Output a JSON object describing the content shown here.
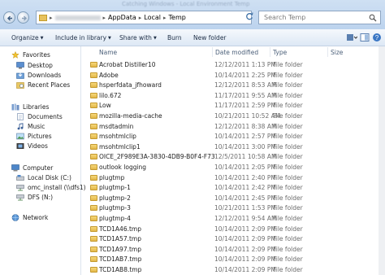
{
  "window": {
    "title": "Catching Windows - Local Environment Temp"
  },
  "address": {
    "segments": [
      "AppData",
      "Local",
      "Temp"
    ]
  },
  "search": {
    "placeholder": "Search Temp"
  },
  "toolbar": {
    "organize": "Organize",
    "include": "Include in library",
    "share": "Share with",
    "burn": "Burn",
    "new_folder": "New folder"
  },
  "nav": {
    "favorites": "Favorites",
    "desktop": "Desktop",
    "downloads": "Downloads",
    "recent": "Recent Places",
    "libraries": "Libraries",
    "documents": "Documents",
    "music": "Music",
    "pictures": "Pictures",
    "videos": "Videos",
    "computer": "Computer",
    "local_disk": "Local Disk (C:)",
    "omc": "omc_install (\\\\dfs1)",
    "dfs": "DFS (N:)",
    "network": "Network"
  },
  "columns": {
    "name": "Name",
    "date": "Date modified",
    "type": "Type",
    "size": "Size"
  },
  "files": [
    {
      "name": "Acrobat Distiller10",
      "date": "12/12/2011 1:13 PM",
      "type": "File folder"
    },
    {
      "name": "Adobe",
      "date": "10/14/2011 2:25 PM",
      "type": "File folder"
    },
    {
      "name": "hsperfdata_jfhoward",
      "date": "12/12/2011 8:53 AM",
      "type": "File folder"
    },
    {
      "name": "lilo.672",
      "date": "11/17/2011 9:55 AM",
      "type": "File folder"
    },
    {
      "name": "Low",
      "date": "11/17/2011 2:59 PM",
      "type": "File folder"
    },
    {
      "name": "mozilla-media-cache",
      "date": "10/21/2011 10:52 AM",
      "type": "File folder"
    },
    {
      "name": "msdtadmin",
      "date": "12/12/2011 8:38 AM",
      "type": "File folder"
    },
    {
      "name": "msohtmlclip",
      "date": "10/14/2011 2:57 PM",
      "type": "File folder"
    },
    {
      "name": "msohtmlclip1",
      "date": "10/14/2011 3:00 PM",
      "type": "File folder"
    },
    {
      "name": "OICE_2F989E3A-3830-4DB9-B0F4-F73556...",
      "date": "12/5/2011 10:58 AM",
      "type": "File folder"
    },
    {
      "name": "outlook logging",
      "date": "10/14/2011 2:05 PM",
      "type": "File folder"
    },
    {
      "name": "plugtmp",
      "date": "10/14/2011 2:40 PM",
      "type": "File folder"
    },
    {
      "name": "plugtmp-1",
      "date": "10/14/2011 2:42 PM",
      "type": "File folder"
    },
    {
      "name": "plugtmp-2",
      "date": "10/14/2011 2:45 PM",
      "type": "File folder"
    },
    {
      "name": "plugtmp-3",
      "date": "10/21/2011 1:53 PM",
      "type": "File folder"
    },
    {
      "name": "plugtmp-4",
      "date": "12/12/2011 9:54 AM",
      "type": "File folder"
    },
    {
      "name": "TCD1A46.tmp",
      "date": "10/14/2011 2:09 PM",
      "type": "File folder"
    },
    {
      "name": "TCD1A57.tmp",
      "date": "10/14/2011 2:09 PM",
      "type": "File folder"
    },
    {
      "name": "TCD1A97.tmp",
      "date": "10/14/2011 2:09 PM",
      "type": "File folder"
    },
    {
      "name": "TCD1AB7.tmp",
      "date": "10/14/2011 2:09 PM",
      "type": "File folder"
    },
    {
      "name": "TCD1AB8.tmp",
      "date": "10/14/2011 2:09 PM",
      "type": "File folder"
    }
  ]
}
